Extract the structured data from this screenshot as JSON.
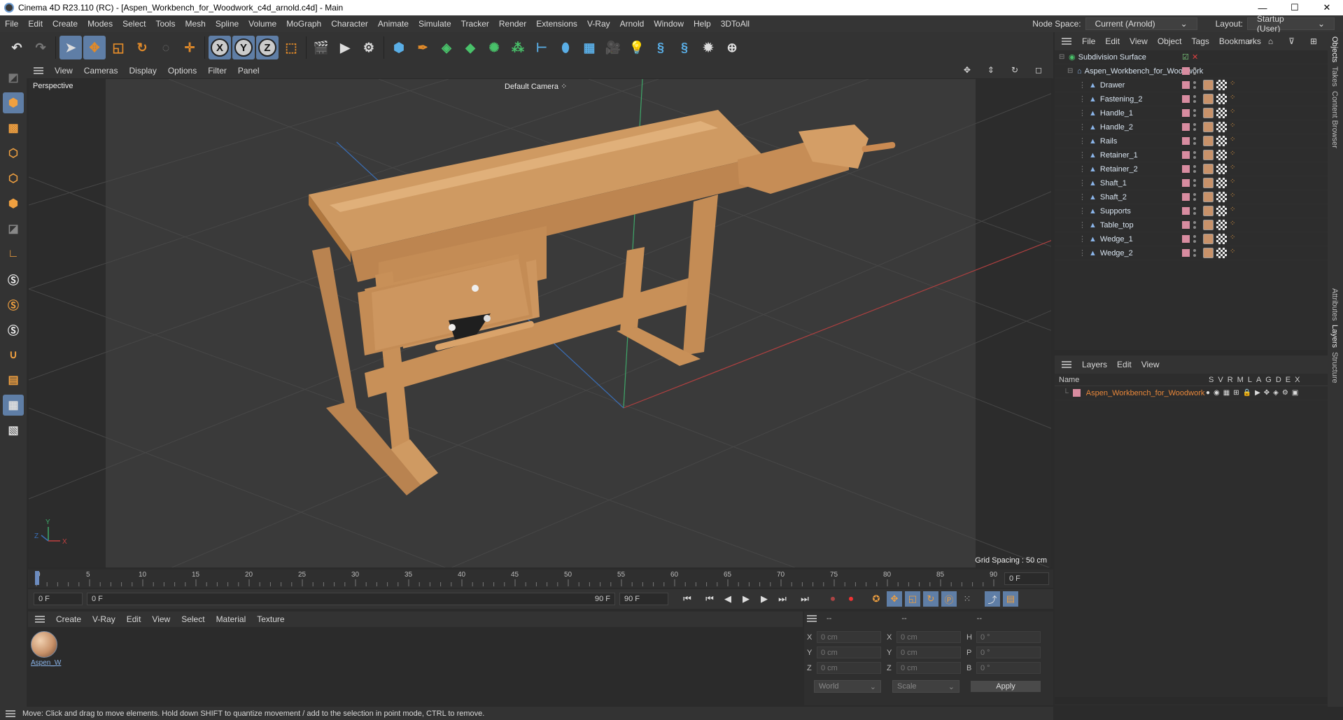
{
  "window": {
    "title": "Cinema 4D R23.110 (RC) - [Aspen_Workbench_for_Woodwork_c4d_arnold.c4d] - Main",
    "minimize": "—",
    "maximize": "☐",
    "close": "✕"
  },
  "menubar": {
    "items": [
      "File",
      "Edit",
      "Create",
      "Modes",
      "Select",
      "Tools",
      "Mesh",
      "Spline",
      "Volume",
      "MoGraph",
      "Character",
      "Animate",
      "Simulate",
      "Tracker",
      "Render",
      "Extensions",
      "V-Ray",
      "Arnold",
      "Window",
      "Help",
      "3DToAll"
    ],
    "node_space_label": "Node Space:",
    "node_space_value": "Current (Arnold)",
    "layout_label": "Layout:",
    "layout_value": "Startup (User)"
  },
  "viewport": {
    "menu": [
      "View",
      "Cameras",
      "Display",
      "Options",
      "Filter",
      "Panel"
    ],
    "label": "Perspective",
    "camera": "Default Camera",
    "grid_spacing": "Grid Spacing : 50 cm"
  },
  "timeline": {
    "ticks": [
      "0",
      "5",
      "10",
      "15",
      "20",
      "25",
      "30",
      "35",
      "40",
      "45",
      "50",
      "55",
      "60",
      "65",
      "70",
      "75",
      "80",
      "85",
      "90"
    ],
    "current_frame_right": "0 F"
  },
  "transport": {
    "start_field": "0 F",
    "range_start": "0 F",
    "range_end": "90 F",
    "end_field": "90 F"
  },
  "material_manager": {
    "menu": [
      "Create",
      "V-Ray",
      "Edit",
      "View",
      "Select",
      "Material",
      "Texture"
    ],
    "material_name": "Aspen_W"
  },
  "coordinates": {
    "header_dashes": [
      "--",
      "--",
      "--"
    ],
    "rows": [
      {
        "l1": "X",
        "v1": "0 cm",
        "l2": "X",
        "v2": "0 cm",
        "l3": "H",
        "v3": "0 °"
      },
      {
        "l1": "Y",
        "v1": "0 cm",
        "l2": "Y",
        "v2": "0 cm",
        "l3": "P",
        "v3": "0 °"
      },
      {
        "l1": "Z",
        "v1": "0 cm",
        "l2": "Z",
        "v2": "0 cm",
        "l3": "B",
        "v3": "0 °"
      }
    ],
    "mode": "World",
    "type": "Scale",
    "apply": "Apply"
  },
  "status": "Move: Click and drag to move elements. Hold down SHIFT to quantize movement / add to the selection in point mode, CTRL to remove.",
  "objects": {
    "menu": [
      "File",
      "Edit",
      "View",
      "Object",
      "Tags",
      "Bookmarks"
    ],
    "root": "Subdivision Surface",
    "group": "Aspen_Workbench_for_Woodwork",
    "children": [
      "Drawer",
      "Fastening_2",
      "Handle_1",
      "Handle_2",
      "Rails",
      "Retainer_1",
      "Retainer_2",
      "Shaft_1",
      "Shaft_2",
      "Supports",
      "Table_top",
      "Wedge_1",
      "Wedge_2"
    ]
  },
  "layers": {
    "menu": [
      "Layers",
      "Edit",
      "View"
    ],
    "col_name": "Name",
    "cols": [
      "S",
      "V",
      "R",
      "M",
      "L",
      "A",
      "G",
      "D",
      "E",
      "X"
    ],
    "layer_name": "Aspen_Workbench_for_Woodwork"
  },
  "side_tabs": [
    "Objects",
    "Takes",
    "Content Browser",
    "Attributes",
    "Layers",
    "Structure"
  ],
  "colors": {
    "accent": "#5f7ea6",
    "layer_color": "#d88ca0",
    "layer_text": "#e8873a",
    "wood": "#d9a36a"
  }
}
